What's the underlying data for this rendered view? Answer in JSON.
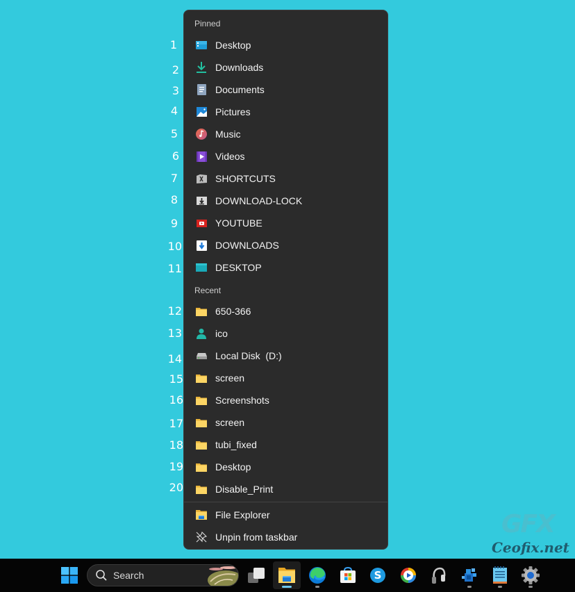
{
  "row_numbers": [
    "1",
    "2",
    "3",
    "4",
    "5",
    "6",
    "7",
    "8",
    "9",
    "10",
    "11",
    "12",
    "13",
    "14",
    "15",
    "16",
    "17",
    "18",
    "19",
    "20"
  ],
  "jump_list": {
    "pinned_label": "Pinned",
    "pinned": [
      {
        "label": "Desktop",
        "icon": "desktop-icon"
      },
      {
        "label": "Downloads",
        "icon": "download-arrow-icon"
      },
      {
        "label": "Documents",
        "icon": "document-icon"
      },
      {
        "label": "Pictures",
        "icon": "pictures-icon"
      },
      {
        "label": "Music",
        "icon": "music-icon"
      },
      {
        "label": "Videos",
        "icon": "videos-icon"
      },
      {
        "label": "SHORTCUTS",
        "icon": "shortcuts-folder-icon"
      },
      {
        "label": "DOWNLOAD-LOCK",
        "icon": "download-lock-folder-icon"
      },
      {
        "label": "YOUTUBE",
        "icon": "youtube-folder-icon"
      },
      {
        "label": "DOWNLOADS",
        "icon": "downloads-folder-icon"
      },
      {
        "label": "DESKTOP",
        "icon": "teal-folder-icon"
      }
    ],
    "recent_label": "Recent",
    "recent": [
      {
        "label": "650-366",
        "icon": "folder-icon"
      },
      {
        "label": "ico",
        "icon": "user-icon"
      },
      {
        "label": "Local Disk  (D:)",
        "icon": "drive-icon"
      },
      {
        "label": "screen",
        "icon": "folder-icon"
      },
      {
        "label": "Screenshots",
        "icon": "folder-icon"
      },
      {
        "label": "screen",
        "icon": "folder-icon"
      },
      {
        "label": "tubi_fixed",
        "icon": "folder-icon"
      },
      {
        "label": "Desktop",
        "icon": "folder-icon"
      },
      {
        "label": "Disable_Print",
        "icon": "folder-icon"
      }
    ],
    "actions": [
      {
        "label": "File Explorer",
        "icon": "file-explorer-icon"
      },
      {
        "label": "Unpin from taskbar",
        "icon": "unpin-icon"
      }
    ]
  },
  "taskbar": {
    "search_placeholder": "Search",
    "apps": [
      {
        "name": "task-view",
        "running": false
      },
      {
        "name": "file-explorer",
        "running": true,
        "active": true
      },
      {
        "name": "edge",
        "running": true
      },
      {
        "name": "microsoft-store",
        "running": false
      },
      {
        "name": "skype",
        "running": false
      },
      {
        "name": "media-player",
        "running": false
      },
      {
        "name": "audio-app",
        "running": false
      },
      {
        "name": "virtualbox",
        "running": true
      },
      {
        "name": "notepad",
        "running": true
      },
      {
        "name": "settings",
        "running": true
      }
    ]
  },
  "watermark": {
    "logo": "GFX",
    "site": "Ceofix.net"
  }
}
